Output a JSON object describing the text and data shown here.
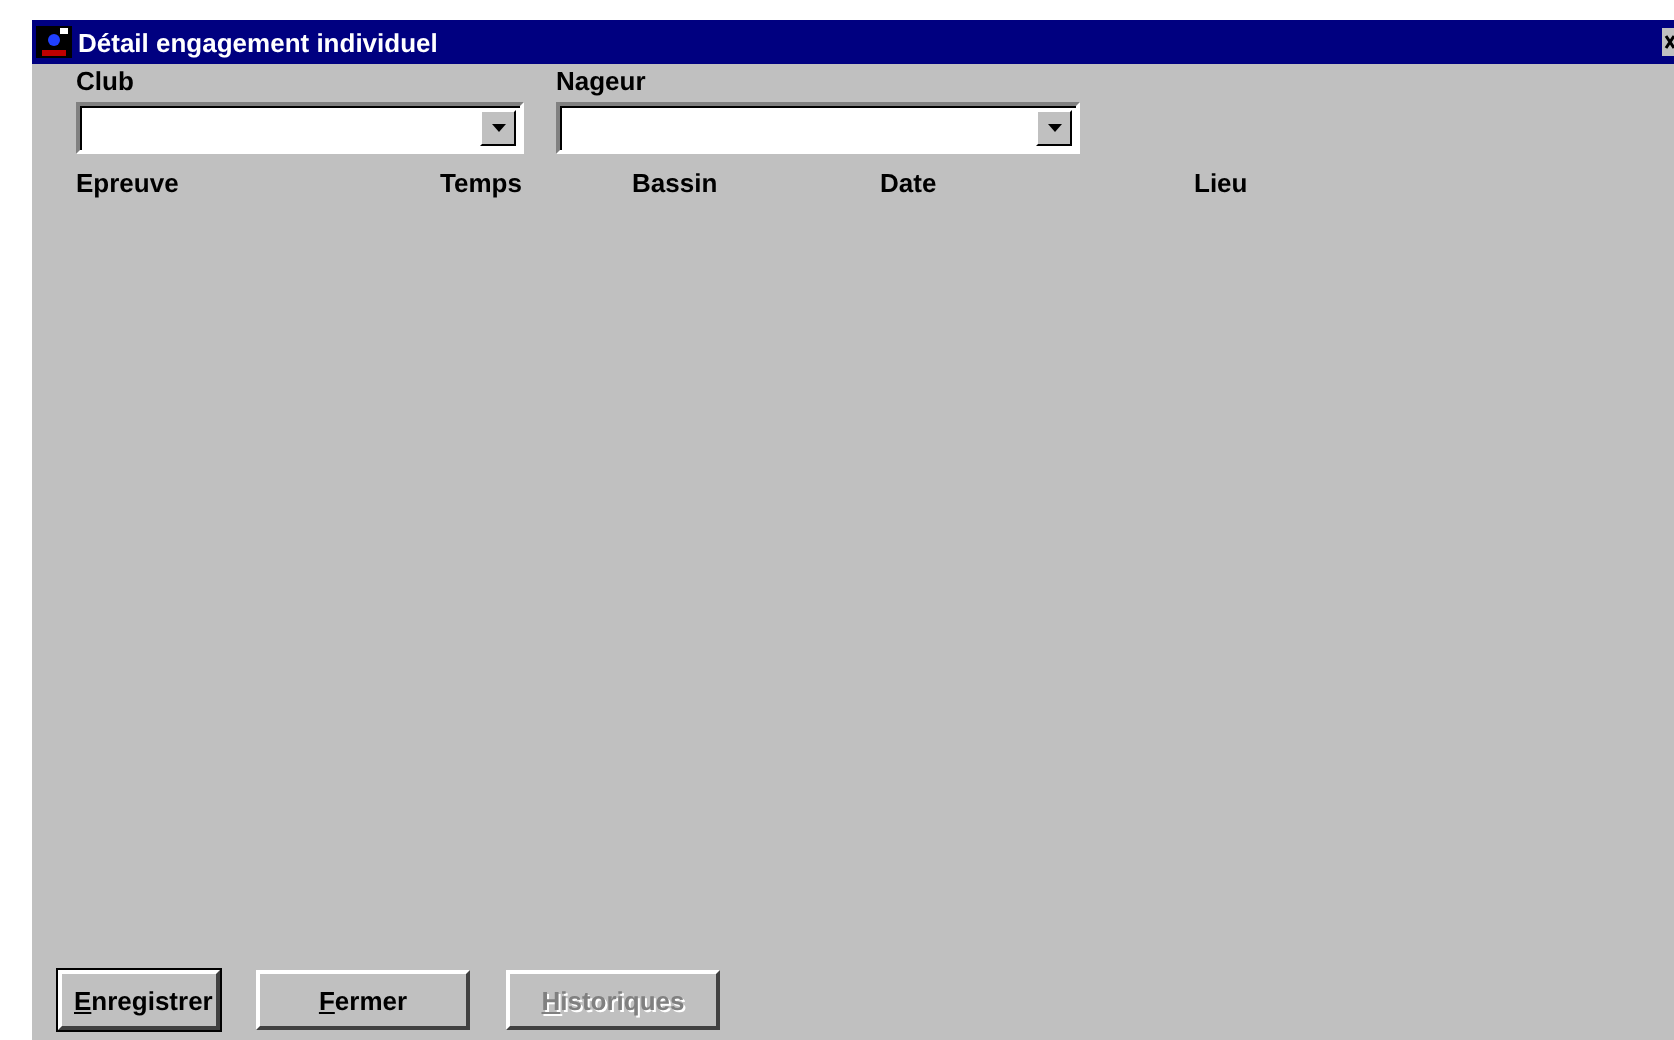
{
  "window": {
    "title": "Détail engagement individuel"
  },
  "fields": [
    {
      "label": "Club"
    },
    {
      "label": "Nageur"
    }
  ],
  "columns": [
    "Epreuve",
    "Temps",
    "Bassin",
    "Date",
    "Lieu"
  ],
  "buttons": [
    {
      "label": "Enregistrer",
      "default": true,
      "disabled": false,
      "mnemonic": true
    },
    {
      "label": "Fermer",
      "default": false,
      "disabled": false,
      "mnemonic": true
    },
    {
      "label": "Historiques",
      "default": false,
      "disabled": true,
      "mnemonic": true
    }
  ]
}
